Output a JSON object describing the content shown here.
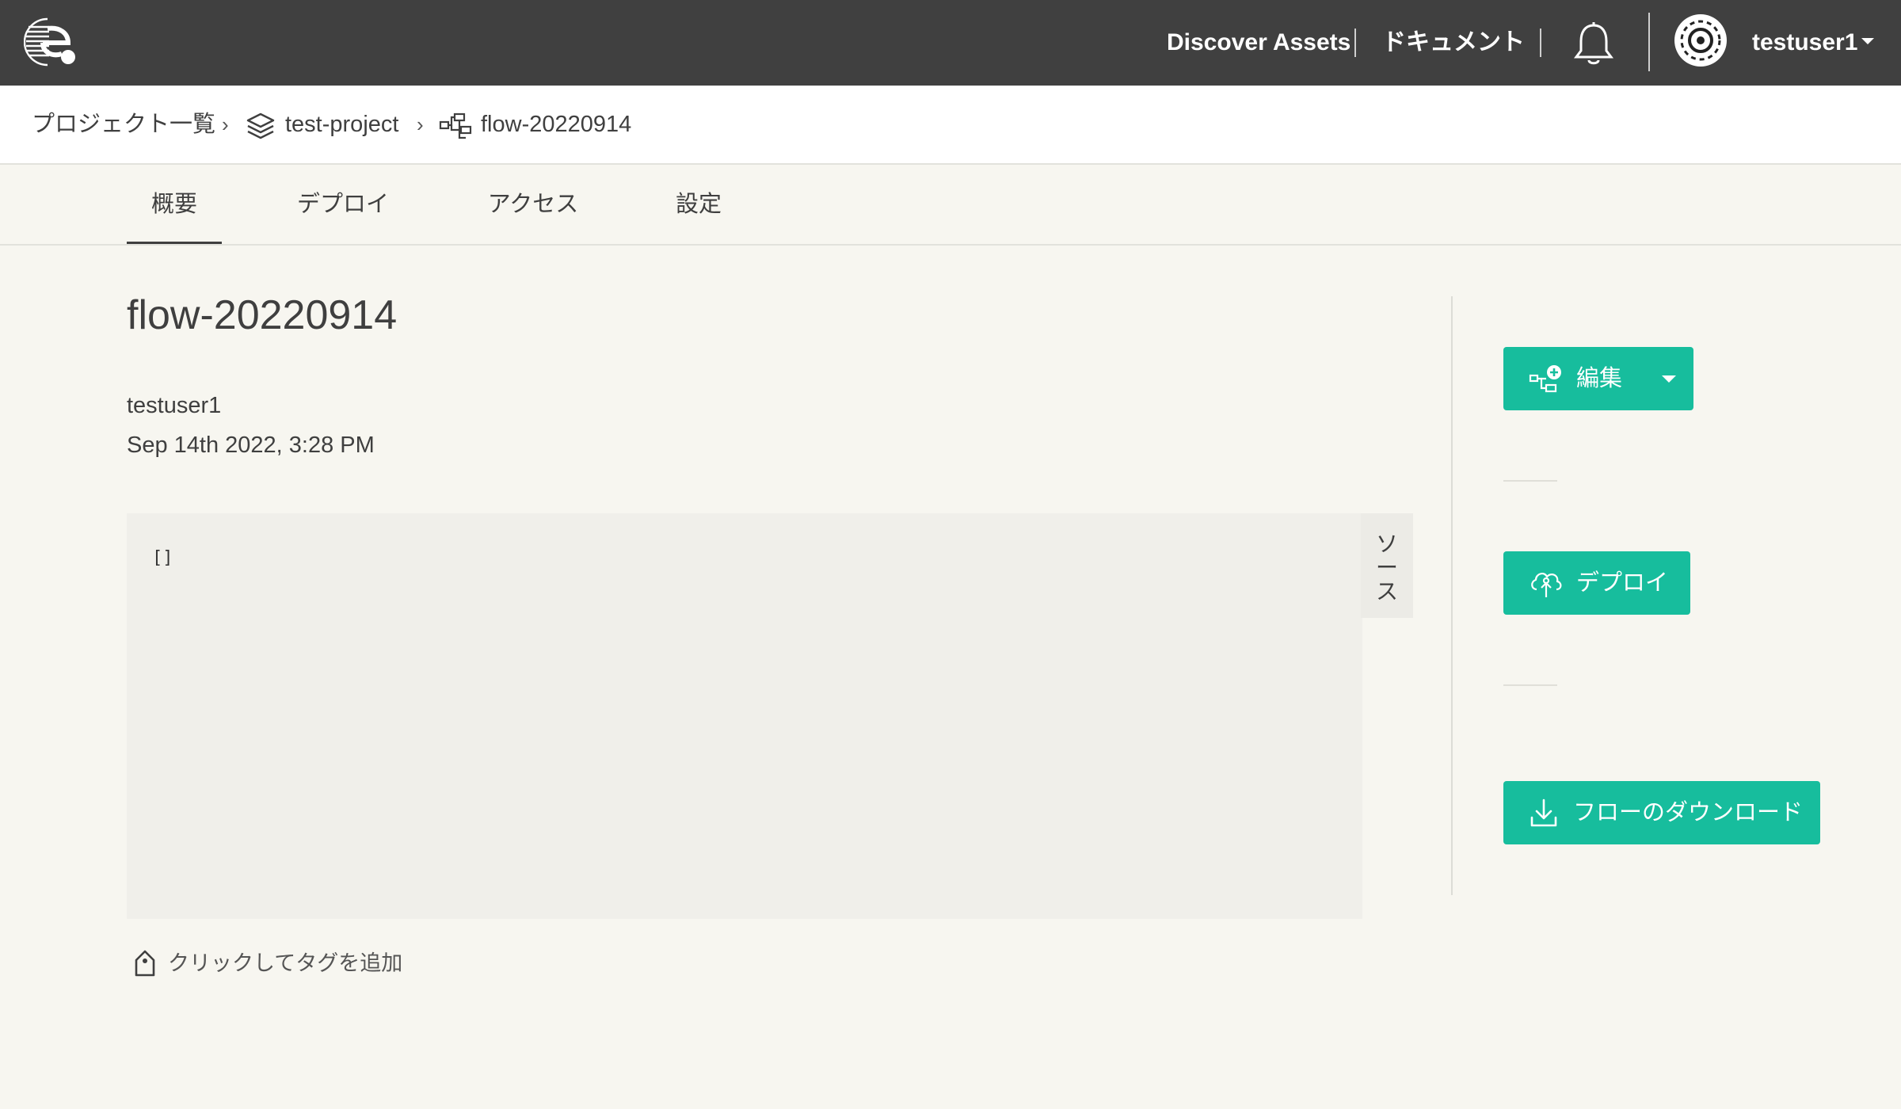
{
  "header": {
    "discover_assets": "Discover Assets",
    "documents": "ドキュメント",
    "username": "testuser1",
    "logo_icon": "e-logo",
    "bell_icon": "bell-icon",
    "avatar_icon": "avatar-icon",
    "background": "#404040"
  },
  "breadcrumb": {
    "items": [
      {
        "label": "プロジェクト一覧"
      },
      {
        "label": "test-project",
        "icon": "layers-icon"
      },
      {
        "label": "flow-20220914",
        "icon": "flow-icon"
      }
    ],
    "separator": "›"
  },
  "tabs": [
    {
      "label": "概要",
      "active": true
    },
    {
      "label": "デプロイ",
      "active": false
    },
    {
      "label": "アクセス",
      "active": false
    },
    {
      "label": "設定",
      "active": false
    }
  ],
  "main": {
    "title": "flow-20220914",
    "owner": "testuser1",
    "date": "Sep 14th 2022, 3:28 PM",
    "code": "[]",
    "source_tab": [
      "ソ",
      "ー",
      "ス"
    ],
    "tag_add": "クリックしてタグを追加",
    "tag_icon": "tag-icon"
  },
  "actions": {
    "edit": "編集",
    "deploy": "デプロイ",
    "download": "フローのダウンロード",
    "accent": "#17bd9d"
  }
}
